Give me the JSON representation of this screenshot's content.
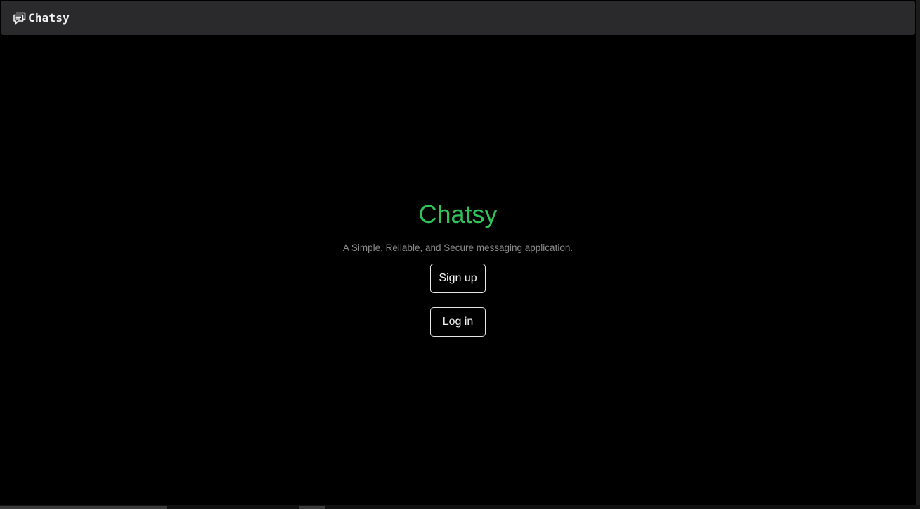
{
  "navbar": {
    "brand_icon": "chat-bubbles-icon",
    "brand_label": "Chatsy"
  },
  "hero": {
    "title": "Chatsy",
    "subtitle": "A Simple, Reliable, and Secure messaging application.",
    "signup_label": "Sign up",
    "login_label": "Log in"
  },
  "colors": {
    "background": "#000000",
    "navbar": "#2a2a2c",
    "accent": "#2fc35a",
    "subtitle": "#8a8a8a",
    "button_border": "#e6e6e6"
  }
}
